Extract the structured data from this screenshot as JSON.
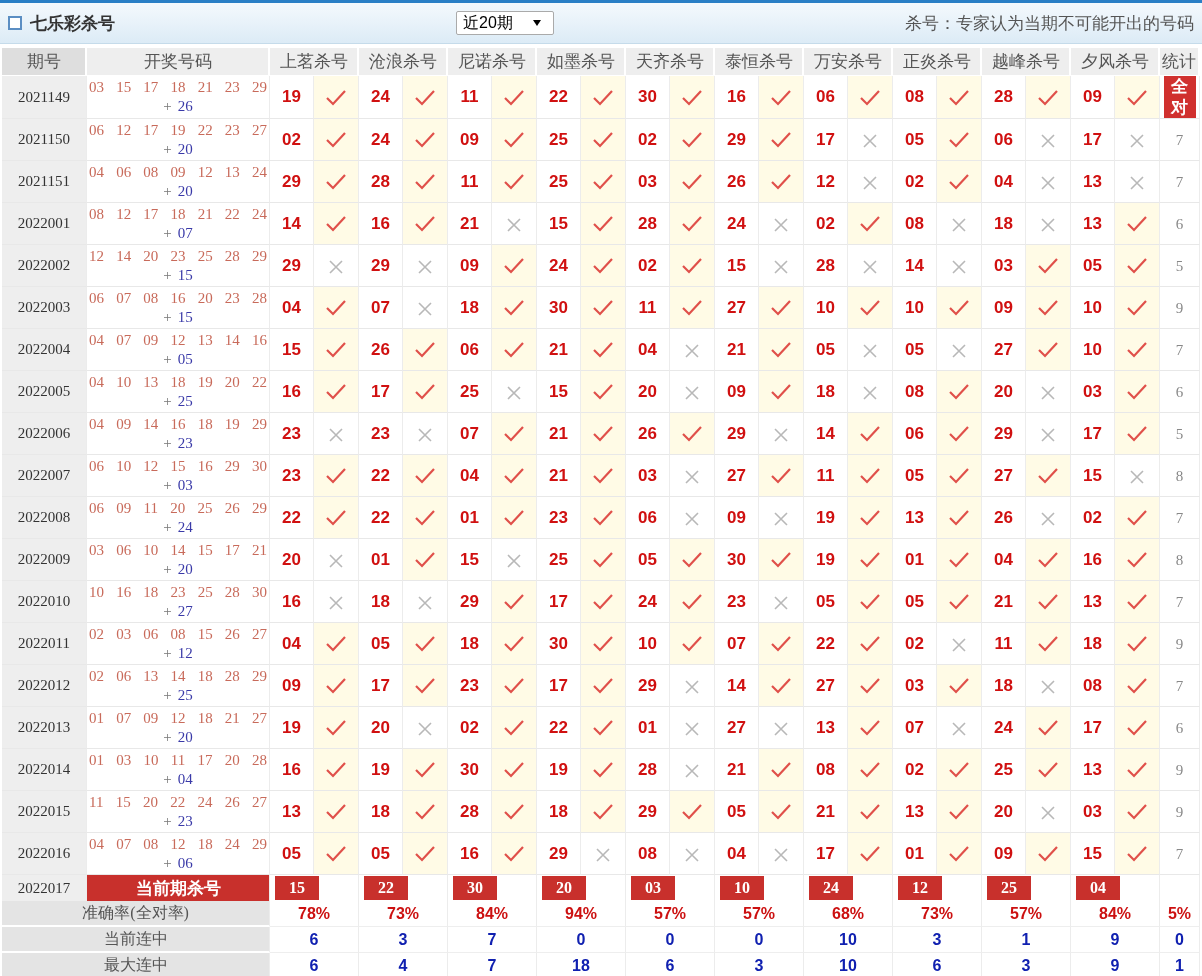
{
  "title": "七乐彩杀号",
  "period_select": {
    "value": "近20期"
  },
  "note": "杀号：专家认为当期不可能开出的号码",
  "columns": {
    "period": "期号",
    "numbers": "开奖号码",
    "experts": [
      "上茗杀号",
      "沧浪杀号",
      "尼诺杀号",
      "如墨杀号",
      "天齐杀号",
      "泰恒杀号",
      "万安杀号",
      "正炎杀号",
      "越峰杀号",
      "夕风杀号"
    ],
    "stat": "统计"
  },
  "rows": [
    {
      "period": "2021149",
      "numbers": [
        "03",
        "15",
        "17",
        "18",
        "21",
        "23",
        "29"
      ],
      "plus": "+",
      "special": "26",
      "picks": [
        {
          "n": "19",
          "hit": true
        },
        {
          "n": "24",
          "hit": true
        },
        {
          "n": "11",
          "hit": true
        },
        {
          "n": "22",
          "hit": true
        },
        {
          "n": "30",
          "hit": true
        },
        {
          "n": "16",
          "hit": true
        },
        {
          "n": "06",
          "hit": true
        },
        {
          "n": "08",
          "hit": true
        },
        {
          "n": "28",
          "hit": true
        },
        {
          "n": "09",
          "hit": true
        }
      ],
      "stat": {
        "kind": "badge",
        "text": "全对"
      }
    },
    {
      "period": "2021150",
      "numbers": [
        "06",
        "12",
        "17",
        "19",
        "22",
        "23",
        "27"
      ],
      "plus": "+",
      "special": "20",
      "picks": [
        {
          "n": "02",
          "hit": true
        },
        {
          "n": "24",
          "hit": true
        },
        {
          "n": "09",
          "hit": true
        },
        {
          "n": "25",
          "hit": true
        },
        {
          "n": "02",
          "hit": true
        },
        {
          "n": "29",
          "hit": true
        },
        {
          "n": "17",
          "hit": false
        },
        {
          "n": "05",
          "hit": true
        },
        {
          "n": "06",
          "hit": false
        },
        {
          "n": "17",
          "hit": false
        }
      ],
      "stat": {
        "kind": "plain",
        "text": "7"
      }
    },
    {
      "period": "2021151",
      "numbers": [
        "04",
        "06",
        "08",
        "09",
        "12",
        "13",
        "24"
      ],
      "plus": "+",
      "special": "20",
      "picks": [
        {
          "n": "29",
          "hit": true
        },
        {
          "n": "28",
          "hit": true
        },
        {
          "n": "11",
          "hit": true
        },
        {
          "n": "25",
          "hit": true
        },
        {
          "n": "03",
          "hit": true
        },
        {
          "n": "26",
          "hit": true
        },
        {
          "n": "12",
          "hit": false
        },
        {
          "n": "02",
          "hit": true
        },
        {
          "n": "04",
          "hit": false
        },
        {
          "n": "13",
          "hit": false
        }
      ],
      "stat": {
        "kind": "plain",
        "text": "7"
      }
    },
    {
      "period": "2022001",
      "numbers": [
        "08",
        "12",
        "17",
        "18",
        "21",
        "22",
        "24"
      ],
      "plus": "+",
      "special": "07",
      "picks": [
        {
          "n": "14",
          "hit": true
        },
        {
          "n": "16",
          "hit": true
        },
        {
          "n": "21",
          "hit": false
        },
        {
          "n": "15",
          "hit": true
        },
        {
          "n": "28",
          "hit": true
        },
        {
          "n": "24",
          "hit": false
        },
        {
          "n": "02",
          "hit": true
        },
        {
          "n": "08",
          "hit": false
        },
        {
          "n": "18",
          "hit": false
        },
        {
          "n": "13",
          "hit": true
        }
      ],
      "stat": {
        "kind": "plain",
        "text": "6"
      }
    },
    {
      "period": "2022002",
      "numbers": [
        "12",
        "14",
        "20",
        "23",
        "25",
        "28",
        "29"
      ],
      "plus": "+",
      "special": "15",
      "picks": [
        {
          "n": "29",
          "hit": false
        },
        {
          "n": "29",
          "hit": false
        },
        {
          "n": "09",
          "hit": true
        },
        {
          "n": "24",
          "hit": true
        },
        {
          "n": "02",
          "hit": true
        },
        {
          "n": "15",
          "hit": false
        },
        {
          "n": "28",
          "hit": false
        },
        {
          "n": "14",
          "hit": false
        },
        {
          "n": "03",
          "hit": true
        },
        {
          "n": "05",
          "hit": true
        }
      ],
      "stat": {
        "kind": "plain",
        "text": "5"
      }
    },
    {
      "period": "2022003",
      "numbers": [
        "06",
        "07",
        "08",
        "16",
        "20",
        "23",
        "28"
      ],
      "plus": "+",
      "special": "15",
      "picks": [
        {
          "n": "04",
          "hit": true
        },
        {
          "n": "07",
          "hit": false
        },
        {
          "n": "18",
          "hit": true
        },
        {
          "n": "30",
          "hit": true
        },
        {
          "n": "11",
          "hit": true
        },
        {
          "n": "27",
          "hit": true
        },
        {
          "n": "10",
          "hit": true
        },
        {
          "n": "10",
          "hit": true
        },
        {
          "n": "09",
          "hit": true
        },
        {
          "n": "10",
          "hit": true
        }
      ],
      "stat": {
        "kind": "plain",
        "text": "9"
      }
    },
    {
      "period": "2022004",
      "numbers": [
        "04",
        "07",
        "09",
        "12",
        "13",
        "14",
        "16"
      ],
      "plus": "+",
      "special": "05",
      "picks": [
        {
          "n": "15",
          "hit": true
        },
        {
          "n": "26",
          "hit": true
        },
        {
          "n": "06",
          "hit": true
        },
        {
          "n": "21",
          "hit": true
        },
        {
          "n": "04",
          "hit": false
        },
        {
          "n": "21",
          "hit": true
        },
        {
          "n": "05",
          "hit": false
        },
        {
          "n": "05",
          "hit": false
        },
        {
          "n": "27",
          "hit": true
        },
        {
          "n": "10",
          "hit": true
        }
      ],
      "stat": {
        "kind": "plain",
        "text": "7"
      }
    },
    {
      "period": "2022005",
      "numbers": [
        "04",
        "10",
        "13",
        "18",
        "19",
        "20",
        "22"
      ],
      "plus": "+",
      "special": "25",
      "picks": [
        {
          "n": "16",
          "hit": true
        },
        {
          "n": "17",
          "hit": true
        },
        {
          "n": "25",
          "hit": false
        },
        {
          "n": "15",
          "hit": true
        },
        {
          "n": "20",
          "hit": false
        },
        {
          "n": "09",
          "hit": true
        },
        {
          "n": "18",
          "hit": false
        },
        {
          "n": "08",
          "hit": true
        },
        {
          "n": "20",
          "hit": false
        },
        {
          "n": "03",
          "hit": true
        }
      ],
      "stat": {
        "kind": "plain",
        "text": "6"
      }
    },
    {
      "period": "2022006",
      "numbers": [
        "04",
        "09",
        "14",
        "16",
        "18",
        "19",
        "29"
      ],
      "plus": "+",
      "special": "23",
      "picks": [
        {
          "n": "23",
          "hit": false
        },
        {
          "n": "23",
          "hit": false
        },
        {
          "n": "07",
          "hit": true
        },
        {
          "n": "21",
          "hit": true
        },
        {
          "n": "26",
          "hit": true
        },
        {
          "n": "29",
          "hit": false
        },
        {
          "n": "14",
          "hit": true
        },
        {
          "n": "06",
          "hit": true
        },
        {
          "n": "29",
          "hit": false
        },
        {
          "n": "17",
          "hit": true
        }
      ],
      "stat": {
        "kind": "plain",
        "text": "5"
      }
    },
    {
      "period": "2022007",
      "numbers": [
        "06",
        "10",
        "12",
        "15",
        "16",
        "29",
        "30"
      ],
      "plus": "+",
      "special": "03",
      "picks": [
        {
          "n": "23",
          "hit": true
        },
        {
          "n": "22",
          "hit": true
        },
        {
          "n": "04",
          "hit": true
        },
        {
          "n": "21",
          "hit": true
        },
        {
          "n": "03",
          "hit": false
        },
        {
          "n": "27",
          "hit": true
        },
        {
          "n": "11",
          "hit": true
        },
        {
          "n": "05",
          "hit": true
        },
        {
          "n": "27",
          "hit": true
        },
        {
          "n": "15",
          "hit": false
        }
      ],
      "stat": {
        "kind": "plain",
        "text": "8"
      }
    },
    {
      "period": "2022008",
      "numbers": [
        "06",
        "09",
        "11",
        "20",
        "25",
        "26",
        "29"
      ],
      "plus": "+",
      "special": "24",
      "picks": [
        {
          "n": "22",
          "hit": true
        },
        {
          "n": "22",
          "hit": true
        },
        {
          "n": "01",
          "hit": true
        },
        {
          "n": "23",
          "hit": true
        },
        {
          "n": "06",
          "hit": false
        },
        {
          "n": "09",
          "hit": false
        },
        {
          "n": "19",
          "hit": true
        },
        {
          "n": "13",
          "hit": true
        },
        {
          "n": "26",
          "hit": false
        },
        {
          "n": "02",
          "hit": true
        }
      ],
      "stat": {
        "kind": "plain",
        "text": "7"
      }
    },
    {
      "period": "2022009",
      "numbers": [
        "03",
        "06",
        "10",
        "14",
        "15",
        "17",
        "21"
      ],
      "plus": "+",
      "special": "20",
      "picks": [
        {
          "n": "20",
          "hit": false
        },
        {
          "n": "01",
          "hit": true
        },
        {
          "n": "15",
          "hit": false
        },
        {
          "n": "25",
          "hit": true
        },
        {
          "n": "05",
          "hit": true
        },
        {
          "n": "30",
          "hit": true
        },
        {
          "n": "19",
          "hit": true
        },
        {
          "n": "01",
          "hit": true
        },
        {
          "n": "04",
          "hit": true
        },
        {
          "n": "16",
          "hit": true
        }
      ],
      "stat": {
        "kind": "plain",
        "text": "8"
      }
    },
    {
      "period": "2022010",
      "numbers": [
        "10",
        "16",
        "18",
        "23",
        "25",
        "28",
        "30"
      ],
      "plus": "+",
      "special": "27",
      "picks": [
        {
          "n": "16",
          "hit": false
        },
        {
          "n": "18",
          "hit": false
        },
        {
          "n": "29",
          "hit": true
        },
        {
          "n": "17",
          "hit": true
        },
        {
          "n": "24",
          "hit": true
        },
        {
          "n": "23",
          "hit": false
        },
        {
          "n": "05",
          "hit": true
        },
        {
          "n": "05",
          "hit": true
        },
        {
          "n": "21",
          "hit": true
        },
        {
          "n": "13",
          "hit": true
        }
      ],
      "stat": {
        "kind": "plain",
        "text": "7"
      }
    },
    {
      "period": "2022011",
      "numbers": [
        "02",
        "03",
        "06",
        "08",
        "15",
        "26",
        "27"
      ],
      "plus": "+",
      "special": "12",
      "picks": [
        {
          "n": "04",
          "hit": true
        },
        {
          "n": "05",
          "hit": true
        },
        {
          "n": "18",
          "hit": true
        },
        {
          "n": "30",
          "hit": true
        },
        {
          "n": "10",
          "hit": true
        },
        {
          "n": "07",
          "hit": true
        },
        {
          "n": "22",
          "hit": true
        },
        {
          "n": "02",
          "hit": false
        },
        {
          "n": "11",
          "hit": true
        },
        {
          "n": "18",
          "hit": true
        }
      ],
      "stat": {
        "kind": "plain",
        "text": "9"
      }
    },
    {
      "period": "2022012",
      "numbers": [
        "02",
        "06",
        "13",
        "14",
        "18",
        "28",
        "29"
      ],
      "plus": "+",
      "special": "25",
      "picks": [
        {
          "n": "09",
          "hit": true
        },
        {
          "n": "17",
          "hit": true
        },
        {
          "n": "23",
          "hit": true
        },
        {
          "n": "17",
          "hit": true
        },
        {
          "n": "29",
          "hit": false
        },
        {
          "n": "14",
          "hit": true
        },
        {
          "n": "27",
          "hit": true
        },
        {
          "n": "03",
          "hit": true
        },
        {
          "n": "18",
          "hit": false
        },
        {
          "n": "08",
          "hit": true
        }
      ],
      "stat": {
        "kind": "plain",
        "text": "7"
      }
    },
    {
      "period": "2022013",
      "numbers": [
        "01",
        "07",
        "09",
        "12",
        "18",
        "21",
        "27"
      ],
      "plus": "+",
      "special": "20",
      "picks": [
        {
          "n": "19",
          "hit": true
        },
        {
          "n": "20",
          "hit": false
        },
        {
          "n": "02",
          "hit": true
        },
        {
          "n": "22",
          "hit": true
        },
        {
          "n": "01",
          "hit": false
        },
        {
          "n": "27",
          "hit": false
        },
        {
          "n": "13",
          "hit": true
        },
        {
          "n": "07",
          "hit": false
        },
        {
          "n": "24",
          "hit": true
        },
        {
          "n": "17",
          "hit": true
        }
      ],
      "stat": {
        "kind": "plain",
        "text": "6"
      }
    },
    {
      "period": "2022014",
      "numbers": [
        "01",
        "03",
        "10",
        "11",
        "17",
        "20",
        "28"
      ],
      "plus": "+",
      "special": "04",
      "picks": [
        {
          "n": "16",
          "hit": true
        },
        {
          "n": "19",
          "hit": true
        },
        {
          "n": "30",
          "hit": true
        },
        {
          "n": "19",
          "hit": true
        },
        {
          "n": "28",
          "hit": false
        },
        {
          "n": "21",
          "hit": true
        },
        {
          "n": "08",
          "hit": true
        },
        {
          "n": "02",
          "hit": true
        },
        {
          "n": "25",
          "hit": true
        },
        {
          "n": "13",
          "hit": true
        }
      ],
      "stat": {
        "kind": "plain",
        "text": "9"
      }
    },
    {
      "period": "2022015",
      "numbers": [
        "11",
        "15",
        "20",
        "22",
        "24",
        "26",
        "27"
      ],
      "plus": "+",
      "special": "23",
      "picks": [
        {
          "n": "13",
          "hit": true
        },
        {
          "n": "18",
          "hit": true
        },
        {
          "n": "28",
          "hit": true
        },
        {
          "n": "18",
          "hit": true
        },
        {
          "n": "29",
          "hit": true
        },
        {
          "n": "05",
          "hit": true
        },
        {
          "n": "21",
          "hit": true
        },
        {
          "n": "13",
          "hit": true
        },
        {
          "n": "20",
          "hit": false
        },
        {
          "n": "03",
          "hit": true
        }
      ],
      "stat": {
        "kind": "plain",
        "text": "9"
      }
    },
    {
      "period": "2022016",
      "numbers": [
        "04",
        "07",
        "08",
        "12",
        "18",
        "24",
        "29"
      ],
      "plus": "+",
      "special": "06",
      "picks": [
        {
          "n": "05",
          "hit": true
        },
        {
          "n": "05",
          "hit": true
        },
        {
          "n": "16",
          "hit": true
        },
        {
          "n": "29",
          "hit": false
        },
        {
          "n": "08",
          "hit": false
        },
        {
          "n": "04",
          "hit": false
        },
        {
          "n": "17",
          "hit": true
        },
        {
          "n": "01",
          "hit": true
        },
        {
          "n": "09",
          "hit": true
        },
        {
          "n": "15",
          "hit": true
        }
      ],
      "stat": {
        "kind": "plain",
        "text": "7"
      }
    }
  ],
  "current": {
    "period": "2022017",
    "label": "当前期杀号",
    "picks": [
      "15",
      "22",
      "30",
      "20",
      "03",
      "10",
      "24",
      "12",
      "25",
      "04"
    ]
  },
  "summary": [
    {
      "label": "准确率(全对率)",
      "kind": "rate",
      "values": [
        "78%",
        "73%",
        "84%",
        "94%",
        "57%",
        "57%",
        "68%",
        "73%",
        "57%",
        "84%"
      ],
      "stat": "5%"
    },
    {
      "label": "当前连中",
      "kind": "count",
      "values": [
        "6",
        "3",
        "7",
        "0",
        "0",
        "0",
        "10",
        "3",
        "1",
        "9"
      ],
      "stat": "0"
    },
    {
      "label": "最大连中",
      "kind": "count",
      "values": [
        "6",
        "4",
        "7",
        "18",
        "6",
        "3",
        "10",
        "6",
        "3",
        "9"
      ],
      "stat": "1"
    }
  ]
}
